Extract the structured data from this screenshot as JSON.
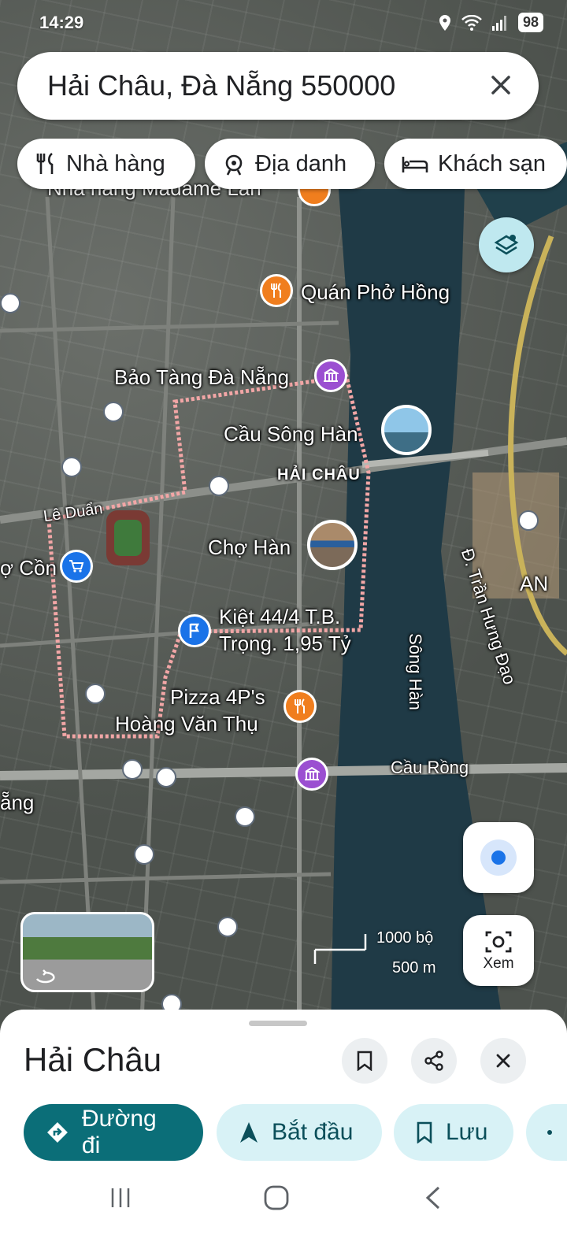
{
  "status_bar": {
    "time": "14:29",
    "battery": "98"
  },
  "search": {
    "query": "Hải Châu, Đà Nẵng 550000"
  },
  "chips": [
    {
      "label": "Nhà hàng",
      "icon": "fork-knife-icon"
    },
    {
      "label": "Địa danh",
      "icon": "landmark-icon"
    },
    {
      "label": "Khách sạn",
      "icon": "bed-icon"
    }
  ],
  "map": {
    "labels": {
      "madame_lan": "Nhà hàng Madame Lan",
      "pho_hong": "Quán Phở Hồng",
      "bao_tang": "Bảo Tàng Đà Nẵng",
      "cau_song_han": "Cầu Sông Hàn",
      "hai_chau": "HẢI CHÂU",
      "le_duan": "Lê Duẩn",
      "cho_con": "ợ Cồn",
      "cho_han": "Chợ Hàn",
      "kiet_line1": "Kiệt 44/4 T.B.",
      "kiet_line2": "Trọng. 1,95 Tỷ",
      "pizza_line1": "Pizza 4P's",
      "pizza_line2": "Hoàng Văn Thụ",
      "song_han": "Sông Hàn",
      "tran_hung_dao": "Đ. Trần Hưng Đạo",
      "cau_rong": "Cầu Rồng",
      "an": "AN",
      "nang": "ẵng"
    },
    "scale": {
      "imperial": "1000 bộ",
      "metric": "500 m"
    },
    "xem_label": "Xem"
  },
  "sheet": {
    "title": "Hải Châu",
    "actions": [
      {
        "label": "Đường đi",
        "icon": "directions-icon"
      },
      {
        "label": "Bắt đầu",
        "icon": "navigation-arrow-icon"
      },
      {
        "label": "Lưu",
        "icon": "bookmark-icon"
      }
    ]
  },
  "colors": {
    "directions_bg": "#0b6e78",
    "action_bg": "#d8f2f6",
    "poi_orange": "#f07e1e",
    "poi_purple": "#9b4fd1",
    "poi_blue": "#1a73e8",
    "river": "#1f3a46"
  }
}
